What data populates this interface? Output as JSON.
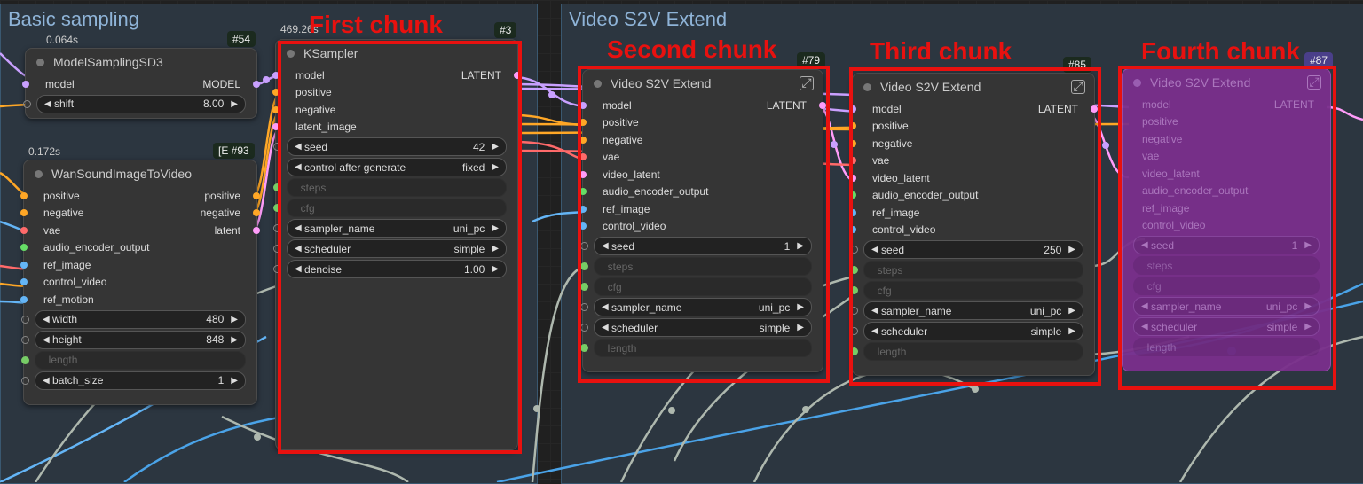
{
  "groups": {
    "basic_sampling": "Basic sampling",
    "video_extend": "Video S2V Extend"
  },
  "chunk_labels": {
    "first": "First chunk",
    "second": "Second chunk",
    "third": "Third chunk",
    "fourth": "Fourth chunk"
  },
  "model_sampling": {
    "timing": "0.064s",
    "badge": "#54",
    "title": "ModelSamplingSD3",
    "input": "model",
    "output": "MODEL",
    "shift_label": "shift",
    "shift_value": "8.00"
  },
  "wan": {
    "timing": "0.172s",
    "badge": "#93",
    "badge_prefix": "[E",
    "title": "WanSoundImageToVideo",
    "inputs": [
      "positive",
      "negative",
      "vae",
      "audio_encoder_output",
      "ref_image",
      "control_video",
      "ref_motion"
    ],
    "outputs": [
      "positive",
      "negative",
      "latent"
    ],
    "width_label": "width",
    "width_value": "480",
    "height_label": "height",
    "height_value": "848",
    "length_label": "length",
    "batch_label": "batch_size",
    "batch_value": "1"
  },
  "ksampler": {
    "timing": "469.26s",
    "badge": "#3",
    "title": "KSampler",
    "inputs": [
      "model",
      "positive",
      "negative",
      "latent_image"
    ],
    "output": "LATENT",
    "seed_label": "seed",
    "seed_value": "42",
    "control_label": "control after generate",
    "control_value": "fixed",
    "steps_label": "steps",
    "cfg_label": "cfg",
    "sampler_label": "sampler_name",
    "sampler_value": "uni_pc",
    "scheduler_label": "scheduler",
    "scheduler_value": "simple",
    "denoise_label": "denoise",
    "denoise_value": "1.00"
  },
  "extend1": {
    "badge": "#79",
    "title": "Video S2V Extend",
    "inputs": [
      "model",
      "positive",
      "negative",
      "vae",
      "video_latent",
      "audio_encoder_output",
      "ref_image",
      "control_video"
    ],
    "output": "LATENT",
    "seed_label": "seed",
    "seed_value": "1",
    "steps_label": "steps",
    "cfg_label": "cfg",
    "sampler_label": "sampler_name",
    "sampler_value": "uni_pc",
    "scheduler_label": "scheduler",
    "scheduler_value": "simple",
    "length_label": "length"
  },
  "extend2": {
    "badge": "#85",
    "title": "Video S2V Extend",
    "inputs": [
      "model",
      "positive",
      "negative",
      "vae",
      "video_latent",
      "audio_encoder_output",
      "ref_image",
      "control_video"
    ],
    "output": "LATENT",
    "seed_label": "seed",
    "seed_value": "250",
    "steps_label": "steps",
    "cfg_label": "cfg",
    "sampler_label": "sampler_name",
    "sampler_value": "uni_pc",
    "scheduler_label": "scheduler",
    "scheduler_value": "simple",
    "length_label": "length"
  },
  "extend3": {
    "badge": "#87",
    "title": "Video S2V Extend",
    "inputs": [
      "model",
      "positive",
      "negative",
      "vae",
      "video_latent",
      "audio_encoder_output",
      "ref_image",
      "control_video"
    ],
    "output": "LATENT",
    "seed_label": "seed",
    "seed_value": "1",
    "steps_label": "steps",
    "cfg_label": "cfg",
    "sampler_label": "sampler_name",
    "sampler_value": "uni_pc",
    "scheduler_label": "scheduler",
    "scheduler_value": "simple",
    "length_label": "length"
  }
}
